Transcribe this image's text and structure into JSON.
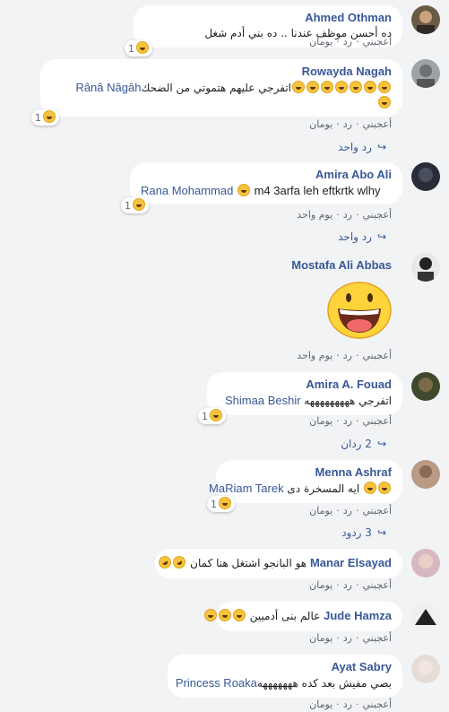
{
  "actions": {
    "like": "أعجبني",
    "reply": "رد",
    "sep": "·"
  },
  "comments": [
    {
      "name": "Ahmed Othman",
      "text": "ده أحسن موظف عندنا .. ده بني أدم شغل",
      "react_count": "1",
      "time": "يومان"
    },
    {
      "name": "Rowayda Nagah",
      "text": "اتفرجي عليهم هتموتي من الضحك",
      "mention": "Rânâ Nâgâh",
      "react_count": "1",
      "time": "يومان",
      "replies": "رد واحد"
    },
    {
      "name": "Amira Abo Ali",
      "text": "m4 3arfa leh eftkrtk wlhy",
      "mention": "Rana Mohammad",
      "react_count": "1",
      "time": "يوم واحد",
      "replies": "رد واحد"
    },
    {
      "name": "Mostafa Ali Abbas",
      "time": "يوم واحد"
    },
    {
      "name": "Amira A. Fouad",
      "text": "اتفرجي هههههههههه",
      "mention": "Shimaa Beshir",
      "react_count": "1",
      "time": "يومان",
      "replies": "2 ردان"
    },
    {
      "name": "Menna Ashraf",
      "text": "ايه المسخرة دى",
      "mention": "MaRiam Tarek",
      "react_count": "1",
      "time": "يومان",
      "replies": "3 ردود"
    },
    {
      "name": "Manar Elsayad",
      "text": "هو البانجو اشتغل هنا كمان",
      "time": "يومان"
    },
    {
      "name": "Jude Hamza",
      "text": "عالم بنى أدميين",
      "time": "يومان"
    },
    {
      "name": "Ayat Sabry",
      "text": "بصي مفيش بعد كده هههههههه",
      "mention": "Princess Roaka",
      "time": "يومان"
    }
  ]
}
